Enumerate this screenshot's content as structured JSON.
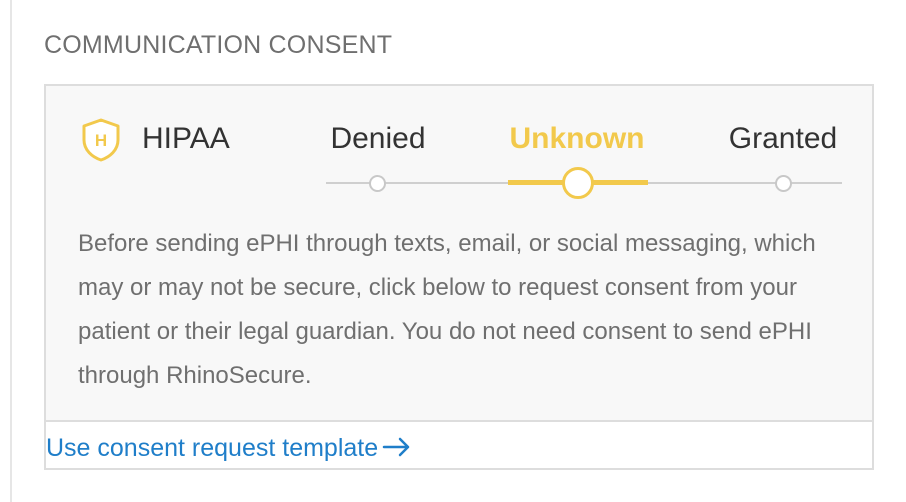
{
  "section": {
    "title": "COMMUNICATION CONSENT"
  },
  "hipaa": {
    "icon": "hipaa-shield-icon",
    "icon_letter": "H",
    "label": "HIPAA",
    "options": [
      {
        "label": "Denied",
        "selected": false
      },
      {
        "label": "Unknown",
        "selected": true
      },
      {
        "label": "Granted",
        "selected": false
      }
    ],
    "description": "Before sending ePHI through texts, email, or social messaging, which may or may not be secure, click below to request consent from your patient or their legal guardian. You do not need consent to send ePHI through RhinoSecure."
  },
  "link": {
    "label": "Use consent request template",
    "icon": "arrow-right-icon"
  },
  "colors": {
    "accent": "#f2c94c",
    "link": "#1f7ec9",
    "muted_text": "#6f6f6f",
    "text": "#333333",
    "panel_bg": "#f8f8f8",
    "border": "#dddddd"
  }
}
